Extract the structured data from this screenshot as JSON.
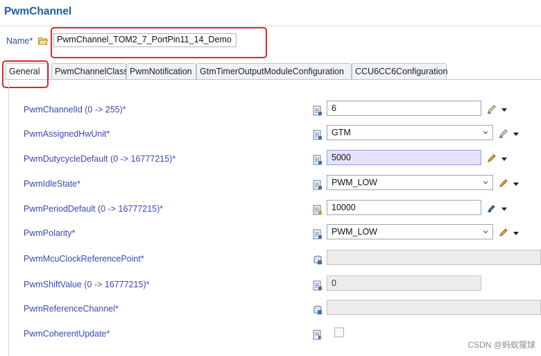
{
  "header": {
    "title": "PwmChannel"
  },
  "name": {
    "label": "Name*",
    "value": "PwmChannel_TOM2_7_PortPin11_14_Demo"
  },
  "tabs": [
    {
      "label": "General",
      "active": true
    },
    {
      "label": "PwmChannelClass"
    },
    {
      "label": "PwmNotification"
    },
    {
      "label": "GtmTimerOutputModuleConfiguration"
    },
    {
      "label": "CCU6CC6Configuration"
    }
  ],
  "params": [
    {
      "label": "PwmChannelId (0 -> 255)*",
      "value": "6",
      "kind": "text"
    },
    {
      "label": "PwmAssignedHwUnit*",
      "value": "GTM",
      "kind": "dropdown"
    },
    {
      "label": "PwmDutycycleDefault (0 -> 16777215)*",
      "value": "5000",
      "kind": "text-highlight"
    },
    {
      "label": "PwmIdleState*",
      "value": "PWM_LOW",
      "kind": "dropdown"
    },
    {
      "label": "PwmPeriodDefault (0 -> 16777215)*",
      "value": "10000",
      "kind": "text"
    },
    {
      "label": "PwmPolarity*",
      "value": "PWM_LOW",
      "kind": "dropdown"
    },
    {
      "label": "PwmMcuClockReferencePoint*",
      "value": "",
      "kind": "disabled"
    },
    {
      "label": "PwmShiftValue (0 -> 16777215)*",
      "value": "0",
      "kind": "disabled"
    },
    {
      "label": "PwmReferenceChannel*",
      "value": "",
      "kind": "disabled"
    },
    {
      "label": "PwmCoherentUpdate*",
      "value": "",
      "kind": "checkbox"
    }
  ],
  "watermark": "CSDN @蚂蚁猩球",
  "colors": {
    "title": "#1e5e9a",
    "param_label": "#3a46b8",
    "highlight_box": "#e0262a"
  }
}
